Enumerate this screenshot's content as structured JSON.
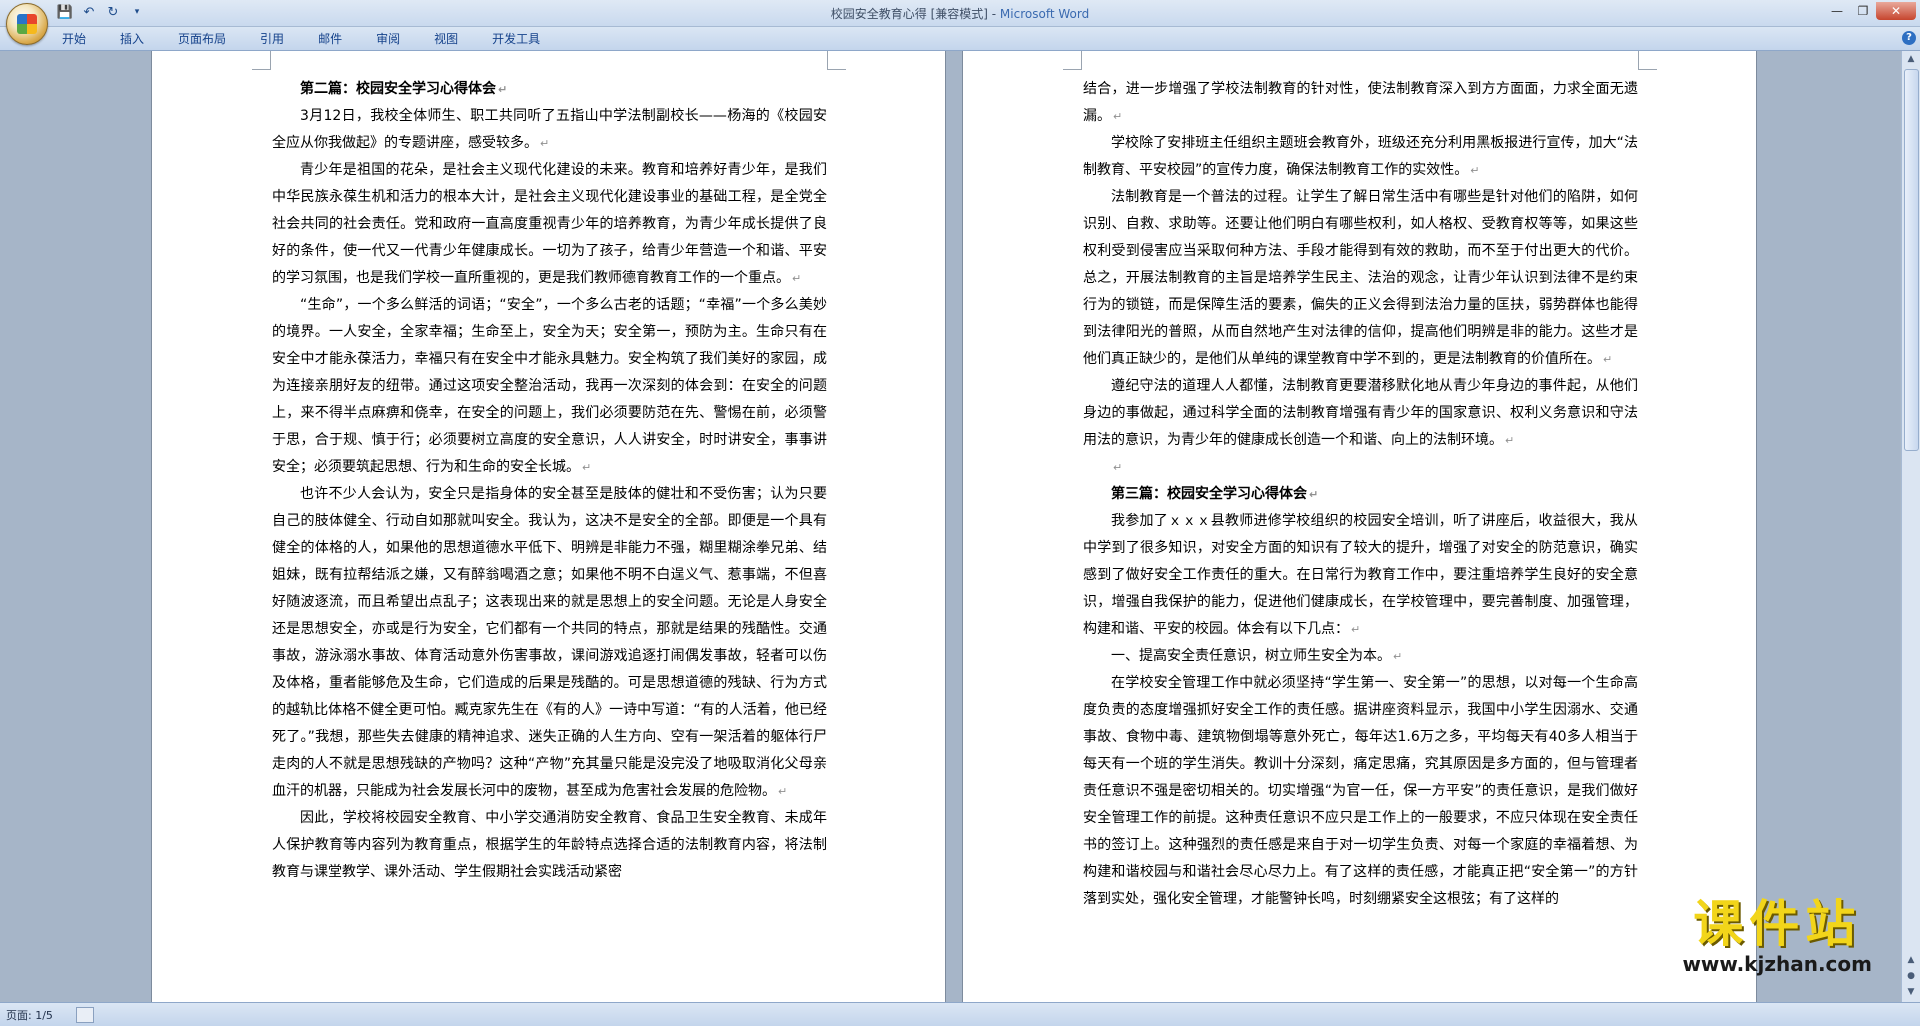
{
  "window": {
    "title_doc": "校园安全教育心得 [兼容模式] - ",
    "title_app": "Microsoft Word"
  },
  "ribbon": {
    "tabs": [
      "开始",
      "插入",
      "页面布局",
      "引用",
      "邮件",
      "审阅",
      "视图",
      "开发工具"
    ]
  },
  "page1": {
    "heading": "第二篇：校园安全学习心得体会",
    "paragraphs": [
      "3月12日，我校全体师生、职工共同听了五指山中学法制副校长——杨海的《校园安全应从你我做起》的专题讲座，感受较多。",
      "青少年是祖国的花朵，是社会主义现代化建设的未来。教育和培养好青少年，是我们中华民族永葆生机和活力的根本大计，是社会主义现代化建设事业的基础工程，是全党全社会共同的社会责任。党和政府一直高度重视青少年的培养教育，为青少年成长提供了良好的条件，使一代又一代青少年健康成长。一切为了孩子，给青少年营造一个和谐、平安的学习氛围，也是我们学校一直所重视的，更是我们教师德育教育工作的一个重点。",
      "“生命”，一个多么鲜活的词语；“安全”，一个多么古老的话题；“幸福”一个多么美妙的境界。一人安全，全家幸福；生命至上，安全为天；安全第一，预防为主。生命只有在安全中才能永葆活力，幸福只有在安全中才能永具魅力。安全构筑了我们美好的家园，成为连接亲朋好友的纽带。通过这项安全整治活动，我再一次深刻的体会到：在安全的问题上，来不得半点麻痹和侥幸，在安全的问题上，我们必须要防范在先、警惕在前，必须警于思，合于规、慎于行；必须要树立高度的安全意识，人人讲安全，时时讲安全，事事讲安全；必须要筑起思想、行为和生命的安全长城。",
      "也许不少人会认为，安全只是指身体的安全甚至是肢体的健壮和不受伤害；认为只要自己的肢体健全、行动自如那就叫安全。我认为，这决不是安全的全部。即便是一个具有健全的体格的人，如果他的思想道德水平低下、明辨是非能力不强，糊里糊涂拳兄弟、结姐妹，既有拉帮结派之嫌，又有醉翁喝酒之意；如果他不明不白逞义气、惹事端，不但喜好随波逐流，而且希望出点乱子；这表现出来的就是思想上的安全问题。无论是人身安全还是思想安全，亦或是行为安全，它们都有一个共同的特点，那就是结果的残酷性。交通事故，游泳溺水事故、体育活动意外伤害事故，课间游戏追逐打闹偶发事故，轻者可以伤及体格，重者能够危及生命，它们造成的后果是残酷的。可是思想道德的残缺、行为方式的越轨比体格不健全更可怕。臧克家先生在《有的人》一诗中写道：“有的人活着，他已经死了。”我想，那些失去健康的精神追求、迷失正确的人生方向、空有一架活着的躯体行尸走肉的人不就是思想残缺的产物吗？这种“产物”充其量只能是没完没了地吸取消化父母亲血汗的机器，只能成为社会发展长河中的废物，甚至成为危害社会发展的危险物。",
      "因此，学校将校园安全教育、中小学交通消防安全教育、食品卫生安全教育、未成年人保护教育等内容列为教育重点，根据学生的年龄特点选择合适的法制教育内容，将法制教育与课堂教学、课外活动、学生假期社会实践活动紧密"
    ]
  },
  "page2": {
    "paragraphs_top": [
      "结合，进一步增强了学校法制教育的针对性，使法制教育深入到方方面面，力求全面无遗漏。",
      "学校除了安排班主任组织主题班会教育外，班级还充分利用黑板报进行宣传，加大“法制教育、平安校园”的宣传力度，确保法制教育工作的实效性。",
      "法制教育是一个普法的过程。让学生了解日常生活中有哪些是针对他们的陷阱，如何识别、自救、求助等。还要让他们明白有哪些权利，如人格权、受教育权等等，如果这些权利受到侵害应当采取何种方法、手段才能得到有效的救助，而不至于付出更大的代价。总之，开展法制教育的主旨是培养学生民主、法治的观念，让青少年认识到法律不是约束行为的锁链，而是保障生活的要素，偏失的正义会得到法治力量的匡扶，弱势群体也能得到法律阳光的普照，从而自然地产生对法律的信仰，提高他们明辨是非的能力。这些才是他们真正缺少的，是他们从单纯的课堂教育中学不到的，更是法制教育的价值所在。",
      "遵纪守法的道理人人都懂，法制教育更要潜移默化地从青少年身边的事件起，从他们身边的事做起，通过科学全面的法制教育增强有青少年的国家意识、权利义务意识和守法用法的意识，为青少年的健康成长创造一个和谐、向上的法制环境。"
    ],
    "heading": "第三篇：校园安全学习心得体会",
    "paragraphs_bottom": [
      "我参加了ｘｘｘ县教师进修学校组织的校园安全培训，听了讲座后，收益很大，我从中学到了很多知识，对安全方面的知识有了较大的提升，增强了对安全的防范意识，确实感到了做好安全工作责任的重大。在日常行为教育工作中，要注重培养学生良好的安全意识，增强自我保护的能力，促进他们健康成长，在学校管理中，要完善制度、加强管理，构建和谐、平安的校园。体会有以下几点：",
      "一、提高安全责任意识，树立师生安全为本。",
      "在学校安全管理工作中就必须坚持“学生第一、安全第一”的思想，以对每一个生命高度负责的态度增强抓好安全工作的责任感。据讲座资料显示，我国中小学生因溺水、交通事故、食物中毒、建筑物倒塌等意外死亡，每年达1.6万之多，平均每天有40多人相当于每天有一个班的学生消失。教训十分深刻，痛定思痛，究其原因是多方面的，但与管理者责任意识不强是密切相关的。切实增强“为官一任，保一方平安”的责任意识，是我们做好安全管理工作的前提。这种责任意识不应只是工作上的一般要求，不应只体现在安全责任书的签订上。这种强烈的责任感是来自于对一切学生负责、对每一个家庭的幸福着想、为构建和谐校园与和谐社会尽心尽力上。有了这样的责任感，才能真正把“安全第一”的方针落到实处，强化安全管理，才能警钟长鸣，时刻绷紧安全这根弦；有了这样的"
    ]
  },
  "status": {
    "page_label": "页面: 1/5"
  },
  "watermark": {
    "brand": "课件站",
    "url": "www.kjzhan.com"
  },
  "icons": {
    "save": "save-icon",
    "undo": "undo-icon",
    "redo": "redo-icon",
    "help": "help-icon"
  }
}
